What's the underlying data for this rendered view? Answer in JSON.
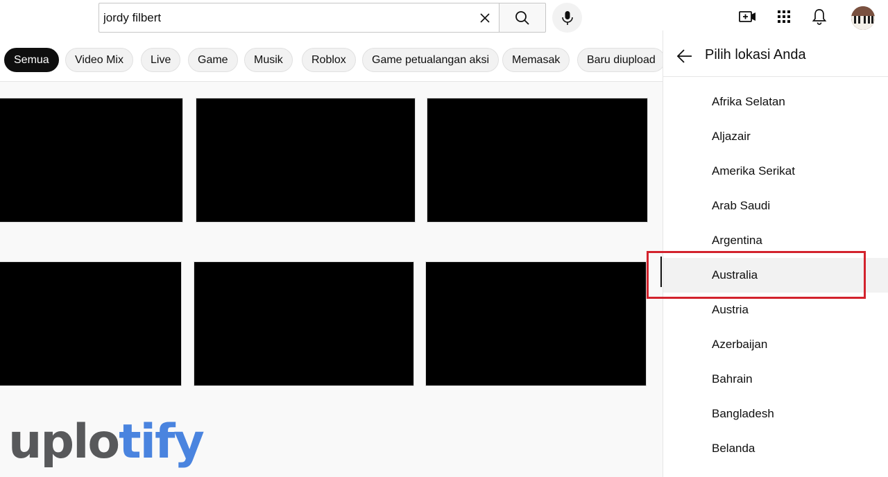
{
  "header": {
    "search_value": "jordy filbert",
    "icons": {
      "clear": "close-icon",
      "search": "search-icon",
      "mic": "mic-icon",
      "create": "video-plus-icon",
      "apps": "apps-grid-icon",
      "notifications": "bell-icon",
      "avatar": "avatar"
    }
  },
  "chips": [
    {
      "label": "Semua",
      "active": true
    },
    {
      "label": "Video Mix"
    },
    {
      "label": "Live"
    },
    {
      "label": "Game"
    },
    {
      "label": "Musik"
    },
    {
      "label": "Roblox"
    },
    {
      "label": "Game petualangan aksi"
    },
    {
      "label": "Memasak"
    },
    {
      "label": "Baru diupload"
    }
  ],
  "location_panel": {
    "title": "Pilih lokasi Anda",
    "back_icon": "arrow-left-icon",
    "selected": "Australia",
    "items": [
      "Afrika Selatan",
      "Aljazair",
      "Amerika Serikat",
      "Arab Saudi",
      "Argentina",
      "Australia",
      "Austria",
      "Azerbaijan",
      "Bahrain",
      "Bangladesh",
      "Belanda"
    ]
  },
  "watermark": {
    "part1": "uplo",
    "part2": "tify"
  },
  "colors": {
    "highlight": "#d3232d",
    "chip_active": "#0f0f0f",
    "watermark_gray": "#58595b",
    "watermark_blue": "#4a84df"
  }
}
